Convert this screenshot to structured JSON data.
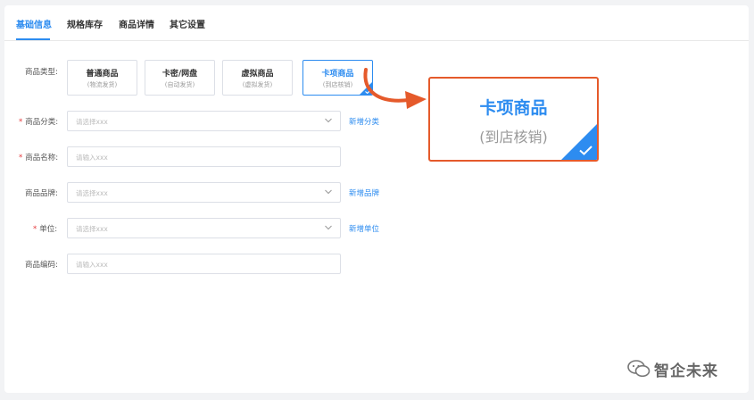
{
  "tabs": [
    {
      "label": "基础信息",
      "active": true
    },
    {
      "label": "规格库存"
    },
    {
      "label": "商品详情"
    },
    {
      "label": "其它设置"
    }
  ],
  "form": {
    "type_label": "商品类型:",
    "types": [
      {
        "name": "普通商品",
        "sub": "(物流发货)"
      },
      {
        "name": "卡密/网盘",
        "sub": "(自动发货)"
      },
      {
        "name": "虚拟商品",
        "sub": "(虚拟发货)"
      },
      {
        "name": "卡项商品",
        "sub": "(到店核销)",
        "selected": true
      }
    ],
    "category": {
      "label": "商品分类:",
      "required": "*",
      "placeholder": "请选择xxx",
      "link": "新增分类"
    },
    "name": {
      "label": "商品名称:",
      "required": "*",
      "placeholder": "请输入xxx"
    },
    "brand": {
      "label": "商品品牌:",
      "placeholder": "请选择xxx",
      "link": "新增品牌"
    },
    "unit": {
      "label": "单位:",
      "required": "*",
      "placeholder": "请选择xxx",
      "link": "新增单位"
    },
    "code": {
      "label": "商品编码:",
      "placeholder": "请输入xxx"
    }
  },
  "callout": {
    "title": "卡项商品",
    "sub": "(到店核销)"
  },
  "watermark": {
    "text": "智企未来"
  },
  "colors": {
    "accent": "#2d8cf0",
    "highlight": "#e55a2b",
    "required": "#e4393c"
  }
}
